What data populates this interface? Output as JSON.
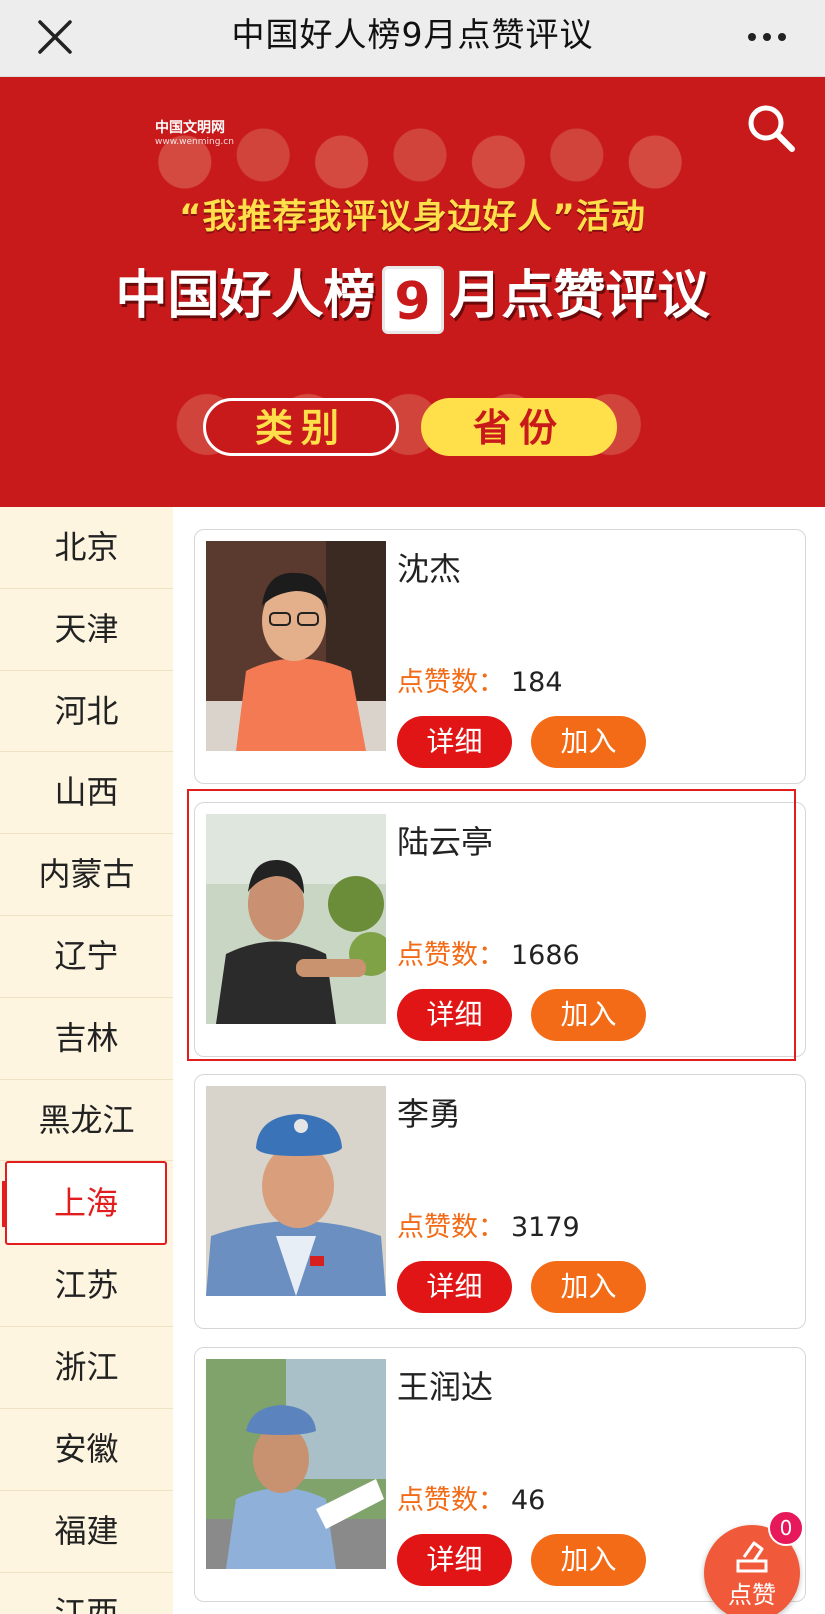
{
  "window": {
    "title": "中国好人榜9月点赞评议"
  },
  "banner": {
    "logo_line1": "中国文明网",
    "logo_line2": "www.wenming.cn",
    "slogan": "“我推荐我评议身边好人”活动",
    "headline_prefix": "中国好人榜",
    "headline_number": "9",
    "headline_suffix": "月点赞评议",
    "tab_category": "类别",
    "tab_province": "省份"
  },
  "sidebar": {
    "items": [
      "北京",
      "天津",
      "河北",
      "山西",
      "内蒙古",
      "辽宁",
      "吉林",
      "黑龙江",
      "上海",
      "江苏",
      "浙江",
      "安徽",
      "福建",
      "江西"
    ],
    "active": "上海"
  },
  "candidates": [
    {
      "name": "沈杰",
      "likes_label": "点赞数：",
      "likes": "184",
      "detail": "详细",
      "join": "加入"
    },
    {
      "name": "陆云亭",
      "likes_label": "点赞数：",
      "likes": "1686",
      "detail": "详细",
      "join": "加入"
    },
    {
      "name": "李勇",
      "likes_label": "点赞数：",
      "likes": "3179",
      "detail": "详细",
      "join": "加入"
    },
    {
      "name": "王润达",
      "likes_label": "点赞数：",
      "likes": "46",
      "detail": "详细",
      "join": "加入"
    }
  ],
  "fab": {
    "label": "点赞",
    "badge": "0"
  },
  "icons": {
    "close": "close-icon",
    "more": "more-icon",
    "search": "search-icon",
    "vote": "vote-icon"
  },
  "colors": {
    "primary_red": "#e11515",
    "orange": "#f36b16",
    "banner_red": "#c8191b",
    "sidebar_bg": "#fdf5e0",
    "gold": "#ffe04a"
  }
}
